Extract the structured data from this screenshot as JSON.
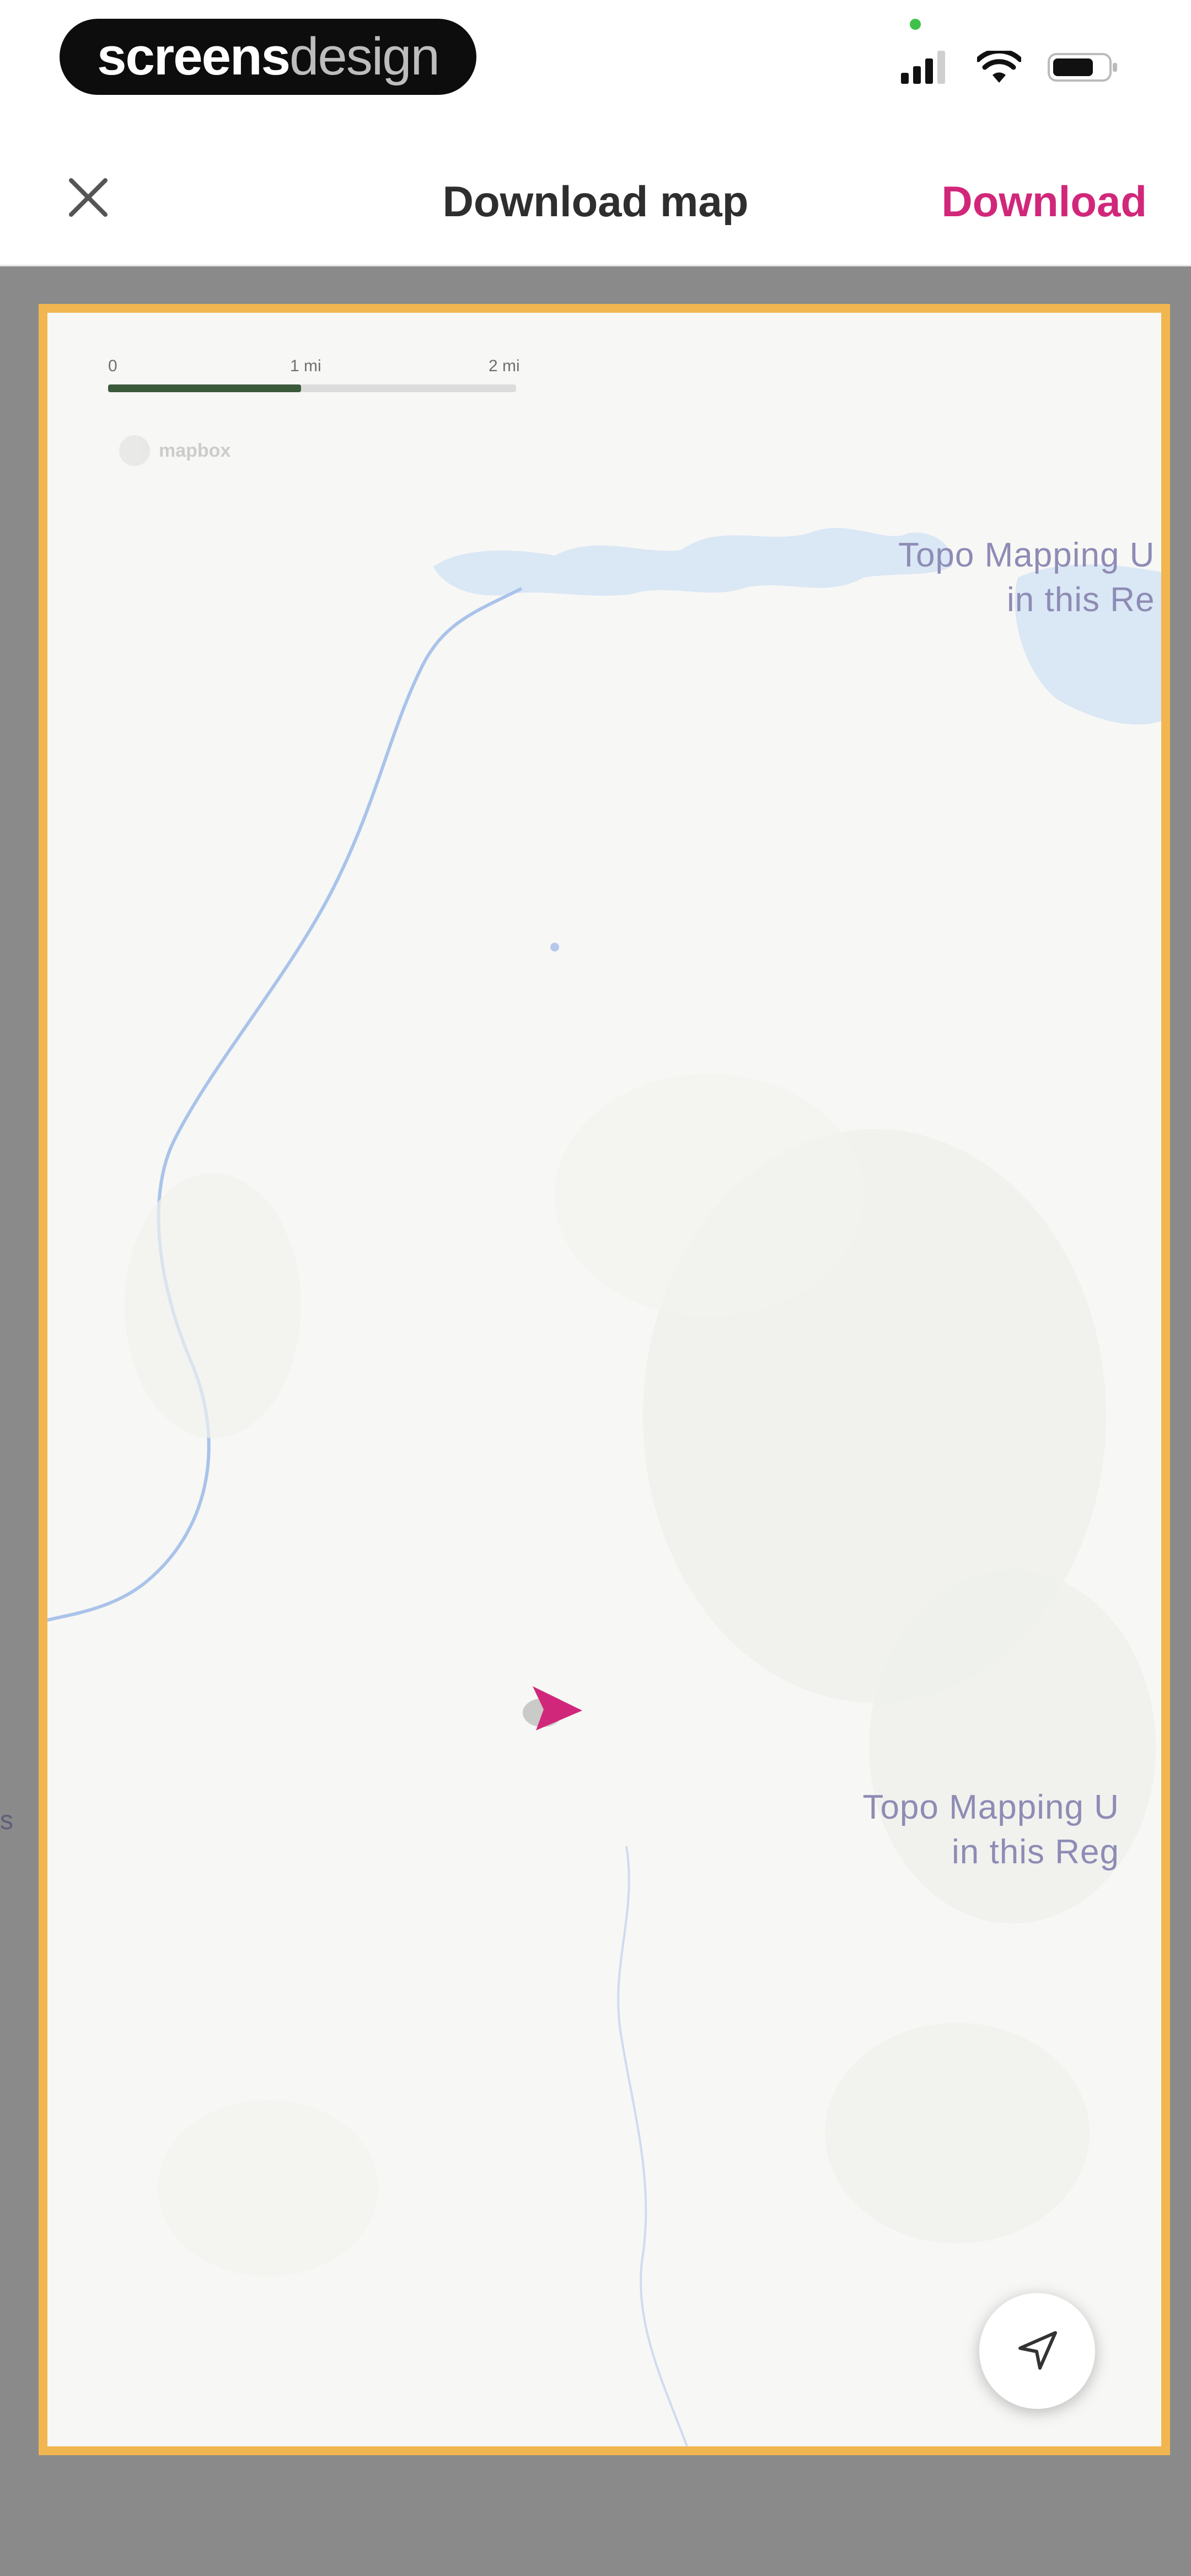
{
  "status_bar": {
    "brand": {
      "strong": "screens",
      "light": "design"
    },
    "icons": [
      "cellular-signal-icon",
      "wifi-icon",
      "battery-icon"
    ]
  },
  "nav": {
    "title": "Download map",
    "close_icon": "close-icon",
    "download_label": "Download"
  },
  "map": {
    "scale": {
      "labels": [
        "0",
        "1 mi",
        "2 mi"
      ]
    },
    "attribution": "mapbox",
    "region_labels": [
      {
        "line1": "Topo Mapping U",
        "line2": "in this Re"
      },
      {
        "line1": "Topo Mapping U",
        "line2": "in this Reg"
      }
    ],
    "edge_label": "s",
    "location_icon": "user-location-arrow-icon",
    "locate_button_icon": "navigation-arrow-icon"
  },
  "colors": {
    "accent": "#d1277a",
    "frame": "#f1b64f",
    "water": "#c9dcf2",
    "map_bg": "#f7f7f5",
    "outside": "#8a8a8a"
  }
}
